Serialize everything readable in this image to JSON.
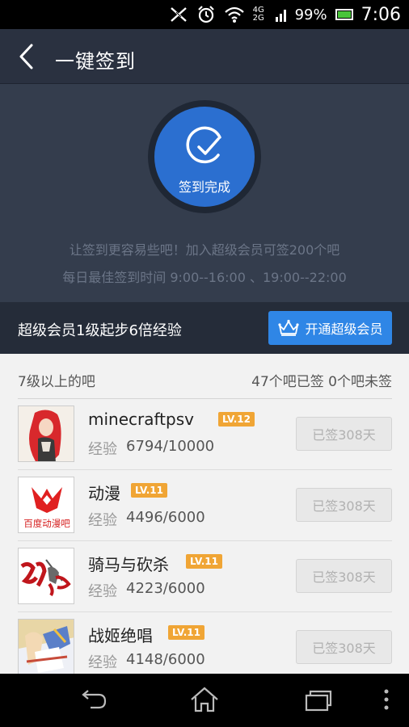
{
  "status_bar": {
    "network": "4G 2G",
    "battery_percent": "99%",
    "time": "7:06",
    "icons": [
      "mute-icon",
      "alarm-icon",
      "wifi-icon",
      "signal-icon",
      "battery-icon"
    ]
  },
  "header": {
    "title": "一键签到",
    "back_icon": "chevron-left-icon"
  },
  "sign_status": {
    "label": "签到完成",
    "icon": "refresh-check-icon",
    "promo_line_1": "让签到更容易些吧！加入超级会员可签200个吧",
    "promo_line_2": "每日最佳签到时间  9:00--16:00 、19:00--22:00"
  },
  "member_bar": {
    "text": "超级会员1级起步6倍经验",
    "button_label": "开通超级会员",
    "button_icon": "crown-icon"
  },
  "list": {
    "header_left": "7级以上的吧",
    "header_right": "47个吧已签 0个吧未签",
    "exp_label": "经验",
    "items": [
      {
        "name": "minecraftpsv",
        "level": "LV.12",
        "exp": "6794/10000",
        "status": "已签308天"
      },
      {
        "name": "动漫",
        "level": "LV.11",
        "exp": "4496/6000",
        "status": "已签308天"
      },
      {
        "name": "骑马与砍杀",
        "level": "LV.11",
        "exp": "4223/6000",
        "status": "已签308天"
      },
      {
        "name": "战姬绝唱",
        "level": "LV.11",
        "exp": "4148/6000",
        "status": "已签308天"
      }
    ],
    "avatar_2_text": "百度动漫吧"
  },
  "colors": {
    "header_bg": "#2a3140",
    "panel_bg": "#343d4d",
    "accent_blue": "#2b6fd0",
    "vip_button": "#2f86e6",
    "level_badge": "#f0a535"
  },
  "nav_bar": {
    "icons": [
      "back-nav-icon",
      "home-icon",
      "recent-apps-icon",
      "menu-icon"
    ]
  }
}
